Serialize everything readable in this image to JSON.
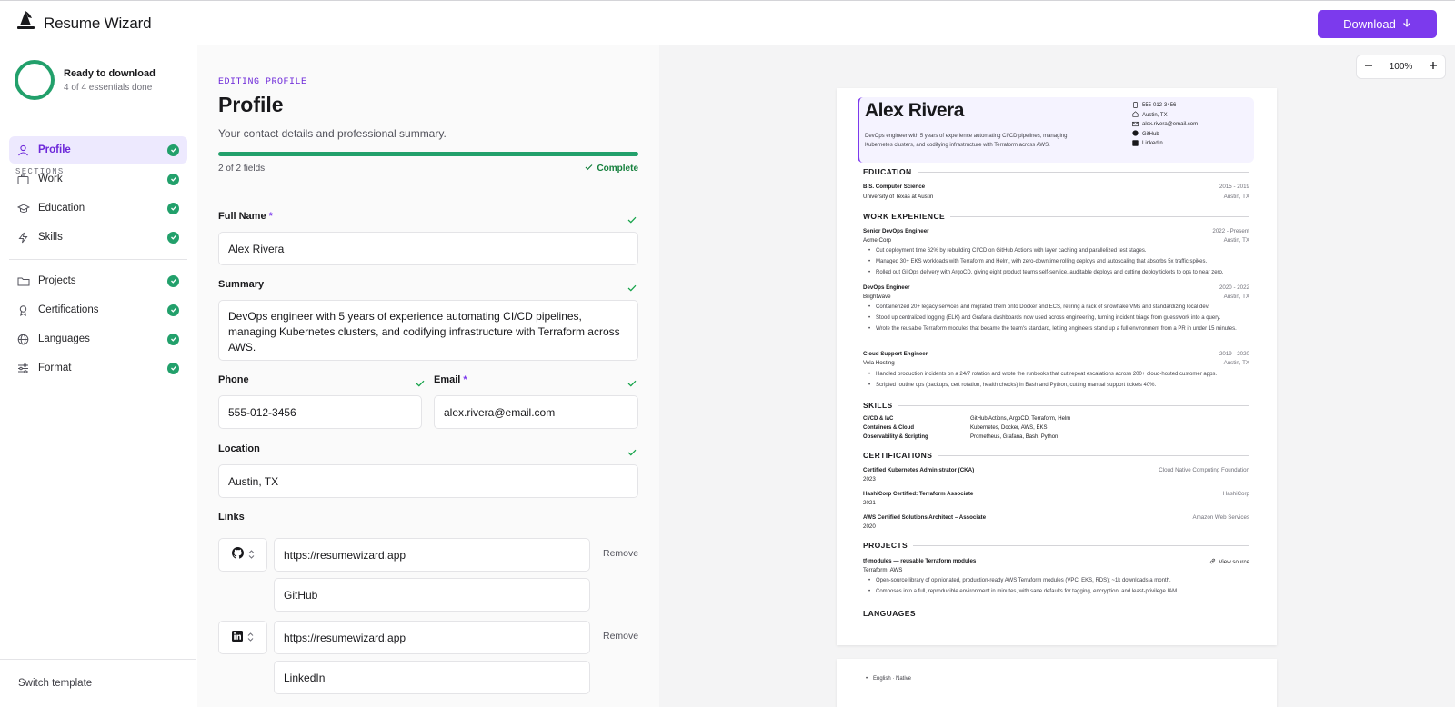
{
  "app": {
    "title": "Resume Wizard",
    "download_label": "Download"
  },
  "sidebar": {
    "status_title": "Ready to download",
    "status_sub": "4 of 4 essentials done",
    "sections_label": "SECTIONS",
    "items": [
      {
        "label": "Profile",
        "done": true
      },
      {
        "label": "Work",
        "done": true
      },
      {
        "label": "Education",
        "done": true
      },
      {
        "label": "Skills",
        "done": true
      },
      {
        "label": "Projects",
        "done": true
      },
      {
        "label": "Certifications",
        "done": true
      },
      {
        "label": "Languages",
        "done": true
      },
      {
        "label": "Format",
        "done": true
      }
    ],
    "switch_template": "Switch template"
  },
  "editor": {
    "eyebrow": "EDITING PROFILE",
    "title": "Profile",
    "subtitle": "Your contact details and professional summary.",
    "progress": 1.0,
    "progress_text": "2 of 2 fields",
    "complete_label": "Complete",
    "full_name_label": "Full Name",
    "full_name": "Alex Rivera",
    "summary_label": "Summary",
    "summary": "DevOps engineer with 5 years of experience automating CI/CD pipelines, managing Kubernetes clusters, and codifying infrastructure with Terraform across AWS.",
    "phone_label": "Phone",
    "phone": "555-012-3456",
    "email_label": "Email",
    "email": "alex.rivera@email.com",
    "location_label": "Location",
    "location": "Austin, TX",
    "links_label": "Links",
    "links": [
      {
        "icon": "github-icon",
        "url": "https://resumewizard.app",
        "label": "GitHub",
        "remove": "Remove"
      },
      {
        "icon": "linkedin-icon",
        "url": "https://resumewizard.app",
        "label": "LinkedIn",
        "remove": "Remove"
      }
    ],
    "required_mark": "*"
  },
  "preview": {
    "zoom": "100%",
    "name": "Alex Rivera",
    "summary": "DevOps engineer with 5 years of experience automating CI/CD pipelines, managing Kubernetes clusters, and codifying infrastructure with Terraform across AWS.",
    "contact": {
      "phone": "555-012-3456",
      "location": "Austin, TX",
      "email": "alex.rivera@email.com",
      "github": "GitHub",
      "linkedin": "LinkedIn"
    },
    "education_h": "EDUCATION",
    "edu": {
      "degree": "B.S. Computer Science",
      "dates": "2015 - 2019",
      "school": "University of Texas at Austin",
      "loc": "Austin, TX"
    },
    "work_h": "WORK EXPERIENCE",
    "jobs": [
      {
        "title": "Senior DevOps Engineer",
        "dates": "2022 - Present",
        "company": "Acme Corp",
        "loc": "Austin, TX",
        "bullets": [
          "Cut deployment time 62% by rebuilding CI/CD on GitHub Actions with layer caching and parallelized test stages.",
          "Managed 30+ EKS workloads with Terraform and Helm, with zero-downtime rolling deploys and autoscaling that absorbs 5x traffic spikes.",
          "Rolled out GitOps delivery with ArgoCD, giving eight product teams self-service, auditable deploys and cutting deploy tickets to ops to near zero."
        ]
      },
      {
        "title": "DevOps Engineer",
        "dates": "2020 - 2022",
        "company": "Brightwave",
        "loc": "Austin, TX",
        "bullets": [
          "Containerized 20+ legacy services and migrated them onto Docker and ECS, retiring a rack of snowflake VMs and standardizing local dev.",
          "Stood up centralized logging (ELK) and Grafana dashboards now used across engineering, turning incident triage from guesswork into a query.",
          "Wrote the reusable Terraform modules that became the team's standard, letting engineers stand up a full environment from a PR in under 15 minutes."
        ]
      },
      {
        "title": "Cloud Support Engineer",
        "dates": "2019 - 2020",
        "company": "Vela Hosting",
        "loc": "Austin, TX",
        "bullets": [
          "Handled production incidents on a 24/7 rotation and wrote the runbooks that cut repeat escalations across 200+ cloud-hosted customer apps.",
          "Scripted routine ops (backups, cert rotation, health checks) in Bash and Python, cutting manual support tickets 40%."
        ]
      }
    ],
    "skills_h": "SKILLS",
    "skills": [
      {
        "k": "CI/CD & IaC",
        "v": "GitHub Actions, ArgoCD, Terraform, Helm"
      },
      {
        "k": "Containers & Cloud",
        "v": "Kubernetes, Docker, AWS, EKS"
      },
      {
        "k": "Observability & Scripting",
        "v": "Prometheus, Grafana, Bash, Python"
      }
    ],
    "certs_h": "CERTIFICATIONS",
    "certs": [
      {
        "name": "Certified Kubernetes Administrator (CKA)",
        "year": "2023",
        "org": "Cloud Native Computing Foundation"
      },
      {
        "name": "HashiCorp Certified: Terraform Associate",
        "year": "2021",
        "org": "HashiCorp"
      },
      {
        "name": "AWS Certified Solutions Architect – Associate",
        "year": "2020",
        "org": "Amazon Web Services"
      }
    ],
    "projects_h": "PROJECTS",
    "project": {
      "name": "tf-modules — reusable Terraform modules",
      "tech": "Terraform, AWS",
      "link": "View source",
      "bullets": [
        "Open-source library of opinionated, production-ready AWS Terraform modules (VPC, EKS, RDS); ~1k downloads a month.",
        "Composes into a full, reproducible environment in minutes, with sane defaults for tagging, encryption, and least-privilege IAM."
      ]
    },
    "languages_h": "LANGUAGES",
    "language": "English · Native"
  }
}
